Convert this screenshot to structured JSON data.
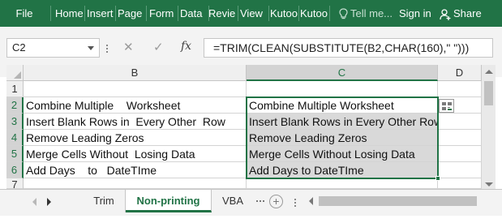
{
  "ribbon": {
    "tabs": [
      "File",
      "Home",
      "Insert",
      "Page",
      "Form",
      "Data",
      "Revie",
      "View",
      "Kutoo",
      "Kutoo"
    ],
    "tell_me": "Tell me...",
    "sign_in": "Sign in",
    "share": "Share"
  },
  "formula_bar": {
    "name_box": "C2",
    "formula": "=TRIM(CLEAN(SUBSTITUTE(B2,CHAR(160),\" \")))"
  },
  "columns": [
    "B",
    "C",
    "D"
  ],
  "rows": [
    {
      "num": "1",
      "b": "",
      "c": ""
    },
    {
      "num": "2",
      "b": "Combine Multiple    Worksheet",
      "c": "Combine Multiple Worksheet"
    },
    {
      "num": "3",
      "b": "Insert Blank Rows in  Every Other  Row",
      "c": "Insert Blank Rows in Every Other Row"
    },
    {
      "num": "4",
      "b": "Remove Leading Zeros",
      "c": "Remove Leading Zeros"
    },
    {
      "num": "5",
      "b": "Merge Cells Without  Losing Data",
      "c": "Merge Cells Without Losing Data"
    },
    {
      "num": "6",
      "b": "Add Days    to   DateTIme",
      "c": "Add Days to DateTIme"
    },
    {
      "num": "7",
      "b": "",
      "c": ""
    }
  ],
  "sheet_tabs": [
    "Trim",
    "Non-printing",
    "VBA"
  ],
  "active_sheet": "Non-printing",
  "colors": {
    "accent": "#217346",
    "selection_fill": "#d9d9d9"
  }
}
